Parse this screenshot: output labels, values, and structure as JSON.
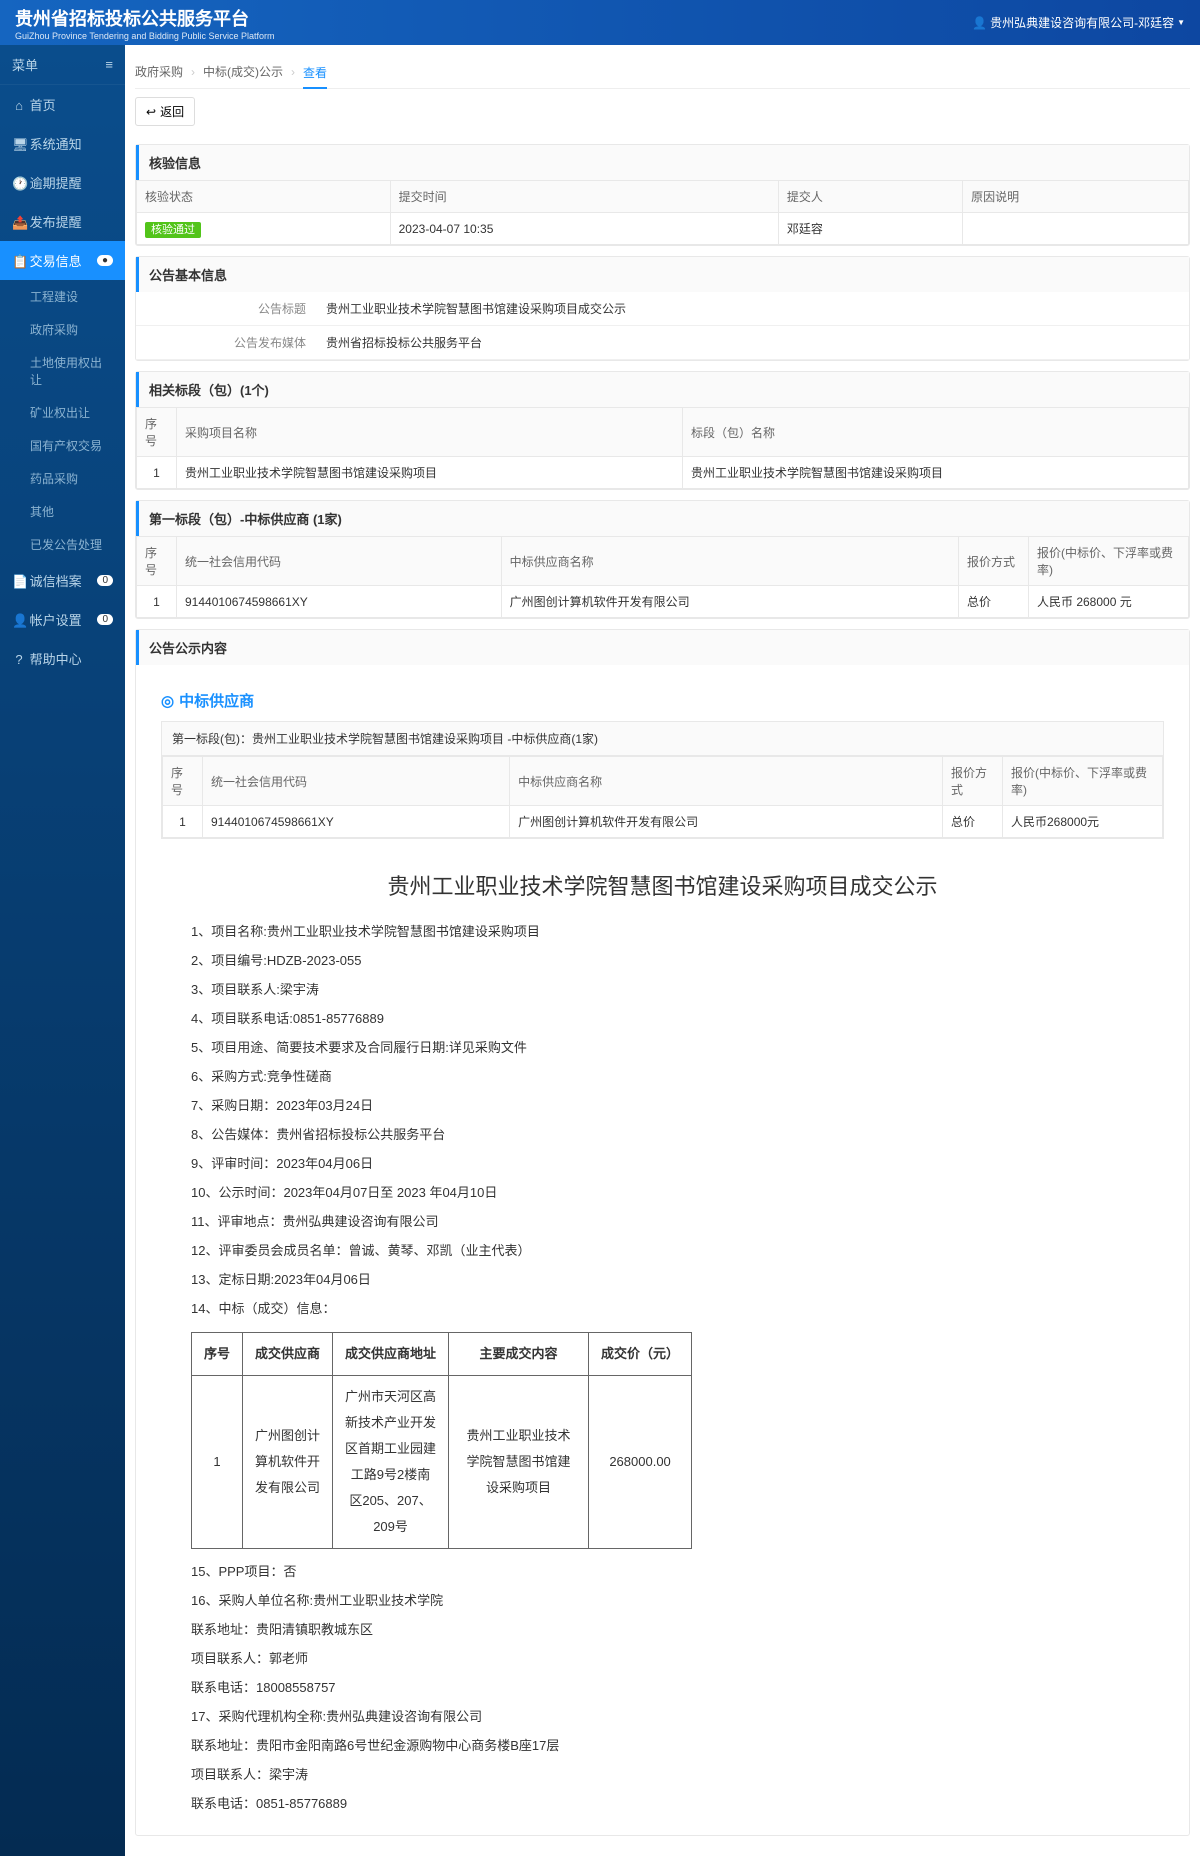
{
  "header": {
    "title": "贵州省招标投标公共服务平台",
    "subtitle": "GuiZhou Province Tendering and Bidding Public Service Platform",
    "user": "贵州弘典建设咨询有限公司-邓廷容"
  },
  "sidebar": {
    "menu_label": "菜单",
    "items": [
      {
        "icon": "⌂",
        "label": "首页"
      },
      {
        "icon": "🖥",
        "label": "系统通知"
      },
      {
        "icon": "🕐",
        "label": "逾期提醒"
      },
      {
        "icon": "📤",
        "label": "发布提醒"
      },
      {
        "icon": "📋",
        "label": "交易信息",
        "active": true,
        "badge": "●"
      },
      {
        "sub": true,
        "label": "工程建设"
      },
      {
        "sub": true,
        "label": "政府采购"
      },
      {
        "sub": true,
        "label": "土地使用权出让"
      },
      {
        "sub": true,
        "label": "矿业权出让"
      },
      {
        "sub": true,
        "label": "国有产权交易"
      },
      {
        "sub": true,
        "label": "药品采购"
      },
      {
        "sub": true,
        "label": "其他"
      },
      {
        "sub": true,
        "label": "已发公告处理"
      },
      {
        "icon": "📄",
        "label": "诚信档案",
        "badge": "0"
      },
      {
        "icon": "👤",
        "label": "帐户设置",
        "badge": "0"
      },
      {
        "icon": "?",
        "label": "帮助中心"
      }
    ]
  },
  "breadcrumb": [
    "政府采购",
    "中标(成交)公示",
    "查看"
  ],
  "back_label": "返回",
  "verify": {
    "title": "核验信息",
    "headers": [
      "核验状态",
      "提交时间",
      "提交人",
      "原因说明"
    ],
    "row": {
      "status": "核验通过",
      "time": "2023-04-07 10:35",
      "person": "邓廷容",
      "reason": ""
    }
  },
  "basic": {
    "title": "公告基本信息",
    "rows": [
      {
        "label": "公告标题",
        "value": "贵州工业职业技术学院智慧图书馆建设采购项目成交公示"
      },
      {
        "label": "公告发布媒体",
        "value": "贵州省招标投标公共服务平台"
      }
    ]
  },
  "sections": {
    "title_related": "相关标段（包）(1个)",
    "headers_related": [
      "序号",
      "采购项目名称",
      "标段（包）名称"
    ],
    "row_related": {
      "no": "1",
      "proj": "贵州工业职业技术学院智慧图书馆建设采购项目",
      "section": "贵州工业职业技术学院智慧图书馆建设采购项目"
    },
    "title_supplier": "第一标段（包）-中标供应商 (1家)",
    "headers_supplier": [
      "序号",
      "统一社会信用代码",
      "中标供应商名称",
      "报价方式",
      "报价(中标价、下浮率或费率)"
    ],
    "row_supplier": {
      "no": "1",
      "code": "9144010674598661XY",
      "name": "广州图创计算机软件开发有限公司",
      "method": "总价",
      "price": "人民币 268000 元"
    }
  },
  "content": {
    "title": "公告公示内容",
    "supplier_heading": "中标供应商",
    "supplier_sub": "第一标段(包)：贵州工业职业技术学院智慧图书馆建设采购项目 -中标供应商(1家)",
    "tbl_headers": [
      "序号",
      "统一社会信用代码",
      "中标供应商名称",
      "报价方式",
      "报价(中标价、下浮率或费率)"
    ],
    "tbl_row": {
      "no": "1",
      "code": "9144010674598661XY",
      "name": "广州图创计算机软件开发有限公司",
      "method": "总价",
      "price": "人民币268000元"
    },
    "big_title": "贵州工业职业技术学院智慧图书馆建设采购项目成交公示",
    "lines": [
      "1、项目名称:贵州工业职业技术学院智慧图书馆建设采购项目",
      "2、项目编号:HDZB-2023-055",
      "3、项目联系人:梁宇涛",
      "4、项目联系电话:0851-85776889",
      "5、项目用途、简要技术要求及合同履行日期:详见采购文件",
      "6、采购方式:竞争性磋商",
      "7、采购日期：2023年03月24日",
      "8、公告媒体：贵州省招标投标公共服务平台",
      "9、评审时间：2023年04月06日",
      "10、公示时间：2023年04月07日至 2023 年04月10日",
      "11、评审地点：贵州弘典建设咨询有限公司",
      "12、评审委员会成员名单：曾诚、黄琴、邓凯（业主代表）",
      "13、定标日期:2023年04月06日",
      "14、中标（成交）信息："
    ],
    "inner_headers": [
      "序号",
      "成交供应商",
      "成交供应商地址",
      "主要成交内容",
      "成交价（元）"
    ],
    "inner_row": {
      "no": "1",
      "name": "广州图创计算机软件开发有限公司",
      "addr": "广州市天河区高新技术产业开发区首期工业园建工路9号2楼南区205、207、209号",
      "content": "贵州工业职业技术学院智慧图书馆建设采购项目",
      "price": "268000.00"
    },
    "lines2": [
      "15、PPP项目：否",
      "16、采购人单位名称:贵州工业职业技术学院",
      "联系地址：贵阳清镇职教城东区",
      "项目联系人：郭老师",
      "联系电话：18008558757",
      "17、采购代理机构全称:贵州弘典建设咨询有限公司",
      "联系地址：贵阳市金阳南路6号世纪金源购物中心商务楼B座17层",
      "项目联系人：梁宇涛",
      "联系电话：0851-85776889"
    ]
  }
}
